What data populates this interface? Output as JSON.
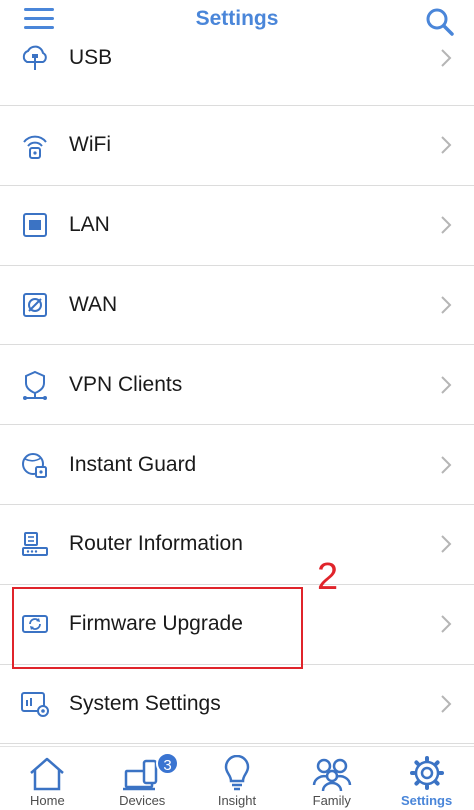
{
  "header": {
    "title": "Settings",
    "menu_icon": "hamburger-menu-icon",
    "search_icon": "search-icon"
  },
  "settings_list": [
    {
      "label": "USB",
      "icon": "usb-cloud-icon"
    },
    {
      "label": "WiFi",
      "icon": "wifi-icon"
    },
    {
      "label": "LAN",
      "icon": "lan-port-icon"
    },
    {
      "label": "WAN",
      "icon": "wan-globe-icon"
    },
    {
      "label": "VPN Clients",
      "icon": "vpn-shield-icon"
    },
    {
      "label": "Instant Guard",
      "icon": "instant-guard-icon"
    },
    {
      "label": "Router Information",
      "icon": "router-icon"
    },
    {
      "label": "Firmware Upgrade",
      "icon": "firmware-upgrade-icon"
    },
    {
      "label": "System Settings",
      "icon": "system-settings-icon"
    }
  ],
  "annotation": {
    "step_number": "2",
    "highlight_color": "#e0242b"
  },
  "tabbar": {
    "tabs": [
      {
        "label": "Home",
        "icon": "home-icon"
      },
      {
        "label": "Devices",
        "icon": "devices-icon",
        "badge": "3"
      },
      {
        "label": "Insight",
        "icon": "lightbulb-icon"
      },
      {
        "label": "Family",
        "icon": "family-icon"
      },
      {
        "label": "Settings",
        "icon": "gear-icon",
        "active": true
      }
    ]
  },
  "colors": {
    "accent": "#4a86d9",
    "divider": "#dcdcdc",
    "badge": "#3a74d1"
  }
}
